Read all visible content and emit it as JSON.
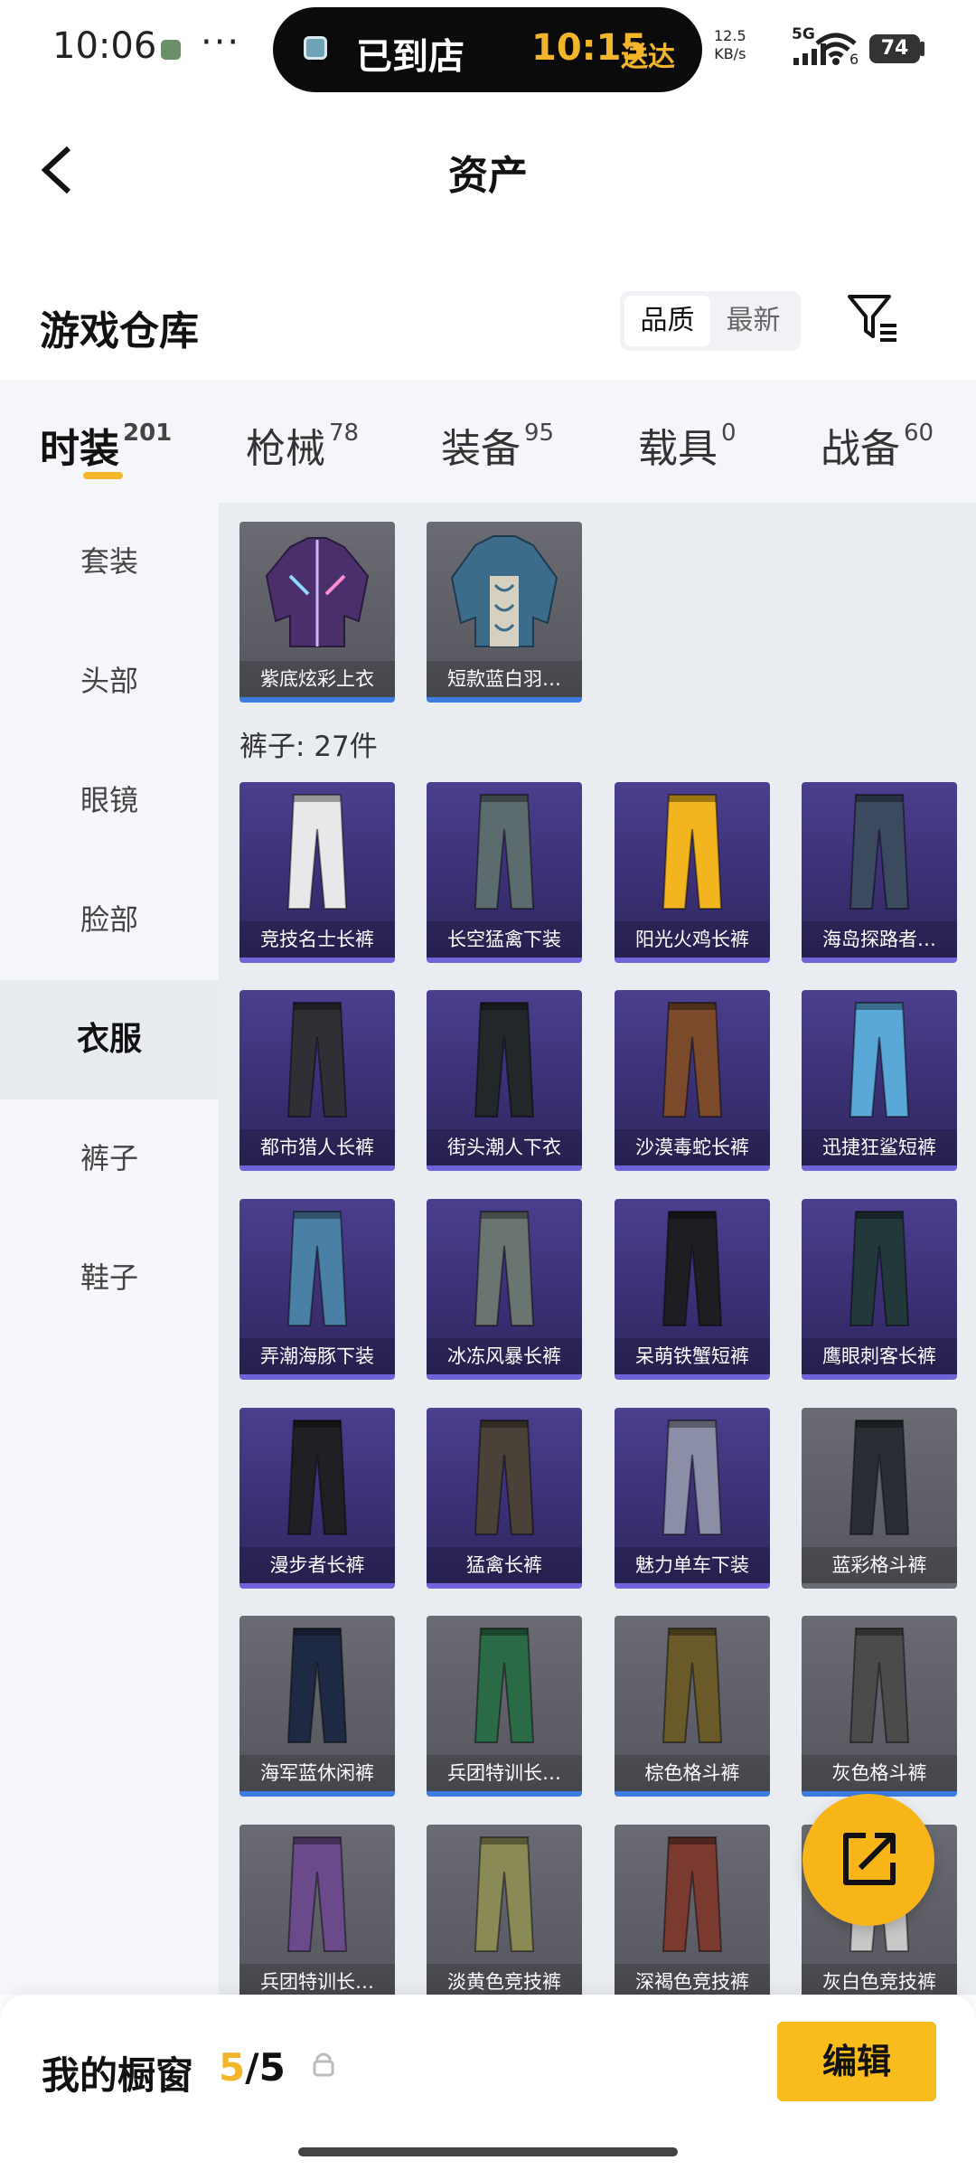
{
  "status_bar": {
    "time": "10:06",
    "dots": "···",
    "island_text": "已到店",
    "island_time": "10:15",
    "island_suffix": "送达",
    "speed_value": "12.5",
    "speed_unit": "KB/s",
    "network": "5G",
    "wifi_sub": "6",
    "battery": "74"
  },
  "header": {
    "title": "资产"
  },
  "warehouse": {
    "title": "游戏仓库",
    "sort_options": [
      "品质",
      "最新"
    ],
    "sort_selected": "品质"
  },
  "tabs": [
    {
      "label": "时装",
      "count": "201",
      "active": true
    },
    {
      "label": "枪械",
      "count": "78"
    },
    {
      "label": "装备",
      "count": "95"
    },
    {
      "label": "载具",
      "count": "0"
    },
    {
      "label": "战备",
      "count": "60"
    }
  ],
  "sidebar": [
    {
      "label": "套装"
    },
    {
      "label": "头部"
    },
    {
      "label": "眼镜"
    },
    {
      "label": "脸部"
    },
    {
      "label": "衣服",
      "active": true
    },
    {
      "label": "裤子"
    },
    {
      "label": "鞋子"
    }
  ],
  "tops": [
    {
      "name": "紫底炫彩上衣",
      "style": "gray",
      "icon": "jacket-purple"
    },
    {
      "name": "短款蓝白羽…",
      "style": "gray",
      "icon": "jacket-blue"
    }
  ],
  "pants_section": {
    "title": "裤子: 27件"
  },
  "pants": [
    {
      "name": "竞技名士长裤",
      "style": "purple",
      "color": "#e8e8ea"
    },
    {
      "name": "长空猛禽下装",
      "style": "purple",
      "color": "#5c6c6e"
    },
    {
      "name": "阳光火鸡长裤",
      "style": "purple",
      "color": "#f2b520"
    },
    {
      "name": "海岛探路者…",
      "style": "purple",
      "color": "#3c4a60"
    },
    {
      "name": "都市猎人长裤",
      "style": "purple",
      "color": "#2e3036"
    },
    {
      "name": "街头潮人下衣",
      "style": "purple",
      "color": "#22282a"
    },
    {
      "name": "沙漠毒蛇长裤",
      "style": "purple",
      "color": "#7a4a2a"
    },
    {
      "name": "迅捷狂鲨短裤",
      "style": "purple",
      "color": "#5aa8d8"
    },
    {
      "name": "弄潮海豚下装",
      "style": "purple",
      "color": "#4a7fa6"
    },
    {
      "name": "冰冻风暴长裤",
      "style": "purple",
      "color": "#6a7470"
    },
    {
      "name": "呆萌铁蟹短裤",
      "style": "purple",
      "color": "#1e1e22"
    },
    {
      "name": "鹰眼刺客长裤",
      "style": "purple",
      "color": "#22383a"
    },
    {
      "name": "漫步者长裤",
      "style": "purple",
      "color": "#202024"
    },
    {
      "name": "猛禽长裤",
      "style": "purple",
      "color": "#4a4238"
    },
    {
      "name": "魅力单车下装",
      "style": "purple",
      "color": "#8a8ea6"
    },
    {
      "name": "蓝彩格斗裤",
      "style": "grayplain",
      "color": "#2a2e34"
    },
    {
      "name": "海军蓝休闲裤",
      "style": "gray",
      "color": "#1e2a44"
    },
    {
      "name": "兵团特训长…",
      "style": "gray",
      "color": "#2a6a46"
    },
    {
      "name": "棕色格斗裤",
      "style": "gray",
      "color": "#6a5a2a"
    },
    {
      "name": "灰色格斗裤",
      "style": "gray",
      "color": "#4a4c4c"
    },
    {
      "name": "兵团特训长…",
      "style": "grayplain",
      "color": "#6a4a8a"
    },
    {
      "name": "淡黄色竞技裤",
      "style": "grayplain",
      "color": "#8a8a56"
    },
    {
      "name": "深褐色竞技裤",
      "style": "grayplain",
      "color": "#7a3a30"
    },
    {
      "name": "灰白色竞技裤",
      "style": "grayplain",
      "color": "#c8c8c8"
    }
  ],
  "bottom_bar": {
    "label": "我的橱窗",
    "count_current": "5",
    "count_sep": "/",
    "count_total": "5",
    "edit_label": "编辑"
  }
}
